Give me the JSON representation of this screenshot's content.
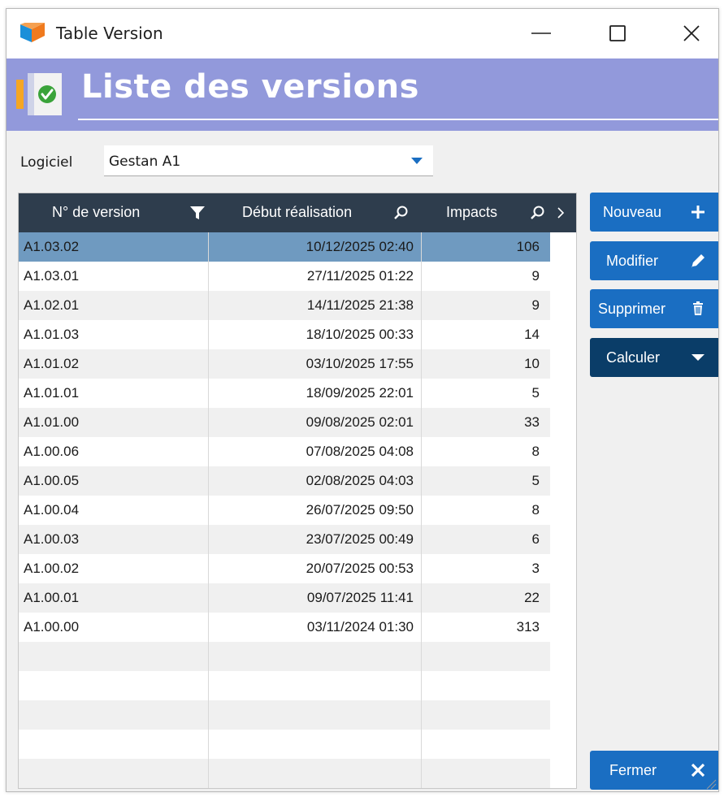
{
  "window": {
    "title": "Table Version"
  },
  "banner": {
    "title": "Liste des versions"
  },
  "logiciel": {
    "label": "Logiciel",
    "value": "Gestan A1"
  },
  "table": {
    "columns": [
      "N° de version",
      "Début réalisation",
      "Impacts"
    ],
    "rows": [
      [
        "A1.03.02",
        "10/12/2025 02:40",
        "106"
      ],
      [
        "A1.03.01",
        "27/11/2025 01:22",
        "9"
      ],
      [
        "A1.02.01",
        "14/11/2025 21:38",
        "9"
      ],
      [
        "A1.01.03",
        "18/10/2025 00:33",
        "14"
      ],
      [
        "A1.01.02",
        "03/10/2025 17:55",
        "10"
      ],
      [
        "A1.01.01",
        "18/09/2025 22:01",
        "5"
      ],
      [
        "A1.01.00",
        "09/08/2025 02:01",
        "33"
      ],
      [
        "A1.00.06",
        "07/08/2025 04:08",
        "8"
      ],
      [
        "A1.00.05",
        "02/08/2025 04:03",
        "5"
      ],
      [
        "A1.00.04",
        "26/07/2025 09:50",
        "8"
      ],
      [
        "A1.00.03",
        "23/07/2025 00:49",
        "6"
      ],
      [
        "A1.00.02",
        "20/07/2025 00:53",
        "3"
      ],
      [
        "A1.00.01",
        "09/07/2025 11:41",
        "22"
      ],
      [
        "A1.00.00",
        "03/11/2024 01:30",
        "313"
      ],
      [
        "",
        "",
        ""
      ],
      [
        "",
        "",
        ""
      ],
      [
        "",
        "",
        ""
      ],
      [
        "",
        "",
        ""
      ],
      [
        "",
        "",
        ""
      ]
    ]
  },
  "buttons": {
    "nouveau": "Nouveau",
    "modifier": "Modifier",
    "supprimer": "Supprimer",
    "calculer": "Calculer",
    "fermer": "Fermer"
  },
  "colors": {
    "banner": "#9299db",
    "header": "#2e3d4d",
    "selected_row": "#6f9ac0",
    "button": "#1a6ec2",
    "button_dark": "#0a3d68"
  }
}
